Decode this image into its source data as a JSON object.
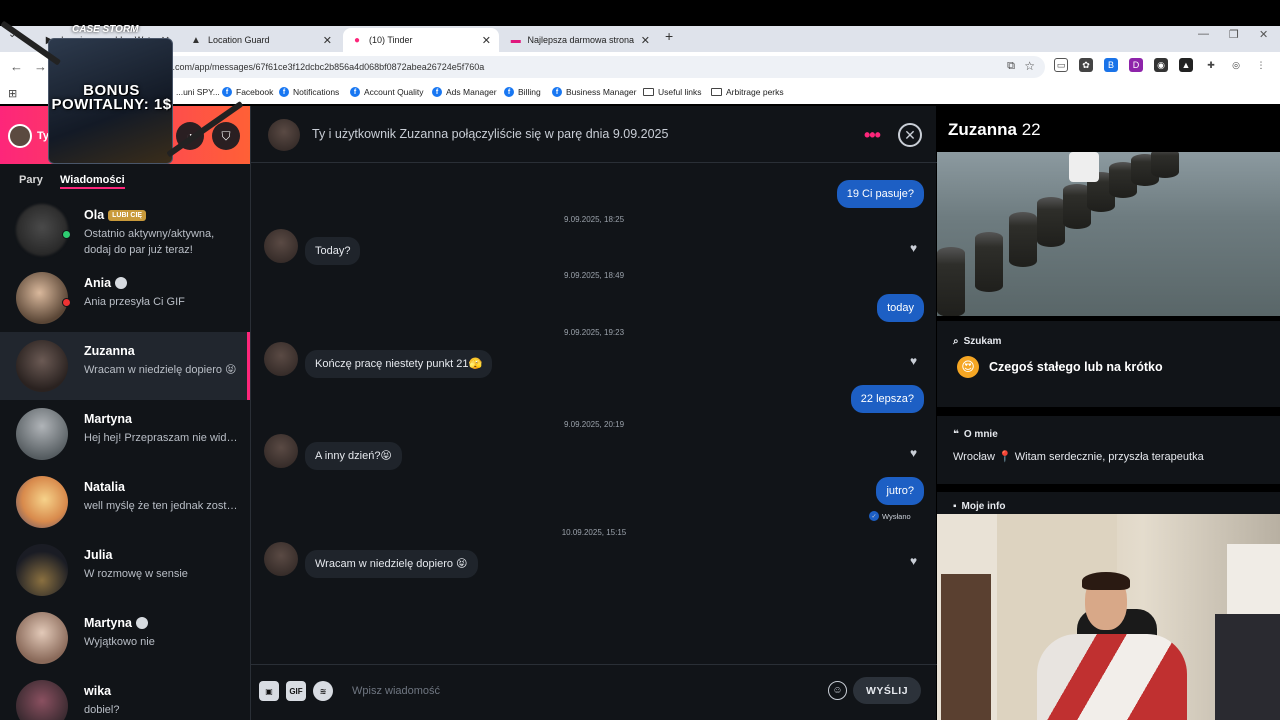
{
  "browser": {
    "tabs": [
      {
        "title": "heysircanmaddy - Watch clips"
      },
      {
        "title": "Location Guard"
      },
      {
        "title": "(10) Tinder"
      },
      {
        "title": "Najlepsza darmowa strona i ap"
      }
    ],
    "url": "r.com/app/messages/67f61ce3f12dcbc2b856a4d068bf0872abea26724e5f760a",
    "bookmarks": [
      {
        "label": "...uni SPY..."
      },
      {
        "label": "Facebook"
      },
      {
        "label": "Notifications"
      },
      {
        "label": "Account Quality"
      },
      {
        "label": "Ads Manager"
      },
      {
        "label": "Billing"
      },
      {
        "label": "Business Manager"
      },
      {
        "label": "Useful links"
      },
      {
        "label": "Arbitrage perks"
      }
    ]
  },
  "promo": {
    "brand": "CASE STORM",
    "text": "BONUS POWITALNY: 1$"
  },
  "sidebar": {
    "header_name": "Ty",
    "tabs": {
      "matches": "Pary",
      "messages": "Wiadomości"
    },
    "matches": [
      {
        "name": "Ola",
        "badge": "LUBI CIĘ",
        "preview": "Ostatnio aktywny/aktywna, dodaj do par już teraz!"
      },
      {
        "name": "Ania",
        "preview": "Ania przesyła Ci GIF"
      },
      {
        "name": "Zuzanna",
        "preview": "Wracam w niedzielę dopiero 😝"
      },
      {
        "name": "Martyna",
        "preview": "Hej hej! Przepraszam nie widziałam"
      },
      {
        "name": "Natalia",
        "preview": "well myślę że ten jednak zostanie"
      },
      {
        "name": "Julia",
        "preview": "W rozmowę w sensie"
      },
      {
        "name": "Martyna",
        "preview": "Wyjątkowo nie"
      },
      {
        "name": "wika",
        "preview": "dobiel?"
      }
    ]
  },
  "chat": {
    "title": "Ty i użytkownik Zuzanna połączyliście się w parę dnia 9.09.2025",
    "messages": [
      {
        "text": "19 Ci pasuje?"
      },
      {
        "time": "9.09.2025, 18:25"
      },
      {
        "text": "Today?"
      },
      {
        "time": "9.09.2025, 18:49"
      },
      {
        "text": "today"
      },
      {
        "time": "9.09.2025, 19:23"
      },
      {
        "text": "Kończę pracę niestety punkt 21🫣"
      },
      {
        "text": "22 lepsza?"
      },
      {
        "time": "9.09.2025, 20:19"
      },
      {
        "text": "A inny dzień?😝"
      },
      {
        "text": "jutro?"
      },
      {
        "time": "10.09.2025, 15:15"
      },
      {
        "text": "Wracam w niedzielę dopiero 😝"
      }
    ],
    "sent_label": "Wysłano",
    "composer": {
      "placeholder": "Wpisz wiadomość",
      "send_label": "WYŚLIJ",
      "gif_label": "GIF"
    }
  },
  "profile": {
    "name": "Zuzanna",
    "age": "22",
    "looking_label": "Szukam",
    "looking_value": "Czegoś stałego lub na krótko",
    "about_label": "O mnie",
    "about_text": "Wrocław 📍 Witam serdecznie, przyszła terapeutka",
    "info_label": "Moje info"
  },
  "colors": {
    "accent": "#fd267a",
    "bubble_out": "#1d5fc4",
    "background": "#111418"
  }
}
